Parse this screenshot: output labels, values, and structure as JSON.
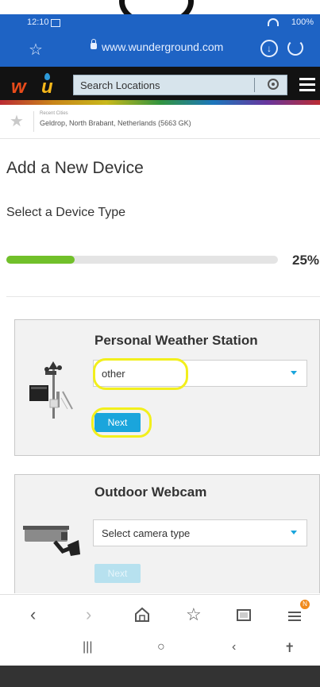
{
  "status_bar": {
    "time": "12:10",
    "battery": "100%"
  },
  "browser": {
    "url": "www.wunderground.com"
  },
  "header": {
    "search_placeholder": "Search Locations"
  },
  "recent": {
    "label": "Recent Cities",
    "location": "Geldrop, North Brabant, Netherlands (5663 GK)"
  },
  "page": {
    "title": "Add a New Device",
    "subtitle": "Select a Device Type",
    "progress_label": "25%",
    "progress_fraction": 0.25
  },
  "cards": {
    "pws": {
      "title": "Personal Weather Station",
      "select_value": "other",
      "next_label": "Next"
    },
    "webcam": {
      "title": "Outdoor Webcam",
      "select_value": "Select camera type",
      "next_label": "Next"
    }
  },
  "colors": {
    "browser_blue": "#1e63c4",
    "progress_green": "#71c02a",
    "button_blue": "#1aa5dc",
    "highlight_yellow": "#f2ef1c"
  }
}
